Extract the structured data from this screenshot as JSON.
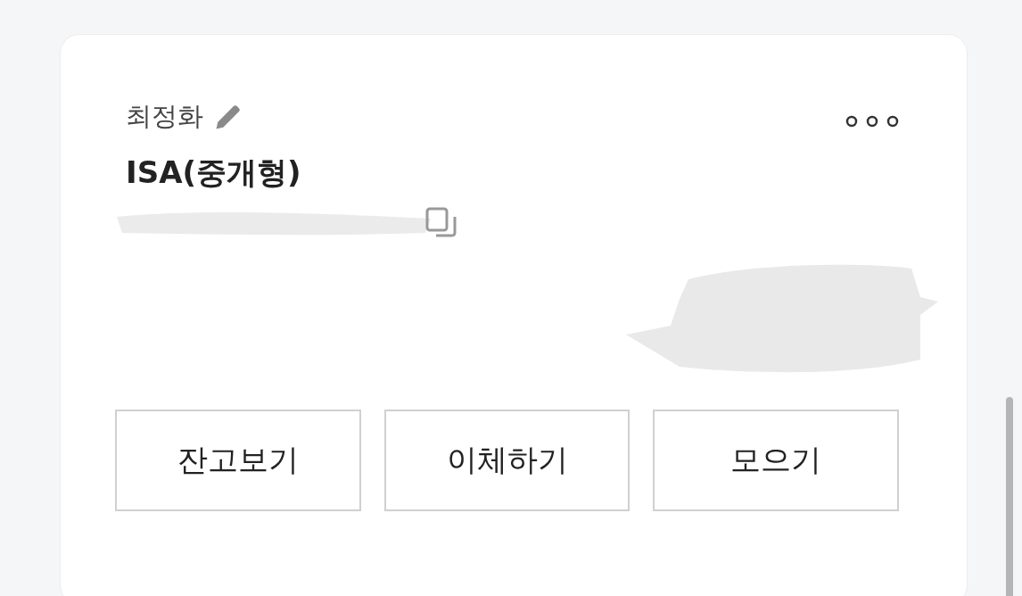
{
  "account": {
    "owner": "최정화",
    "type": "ISA(중개형)"
  },
  "buttons": [
    "잔고보기",
    "이체하기",
    "모으기"
  ]
}
